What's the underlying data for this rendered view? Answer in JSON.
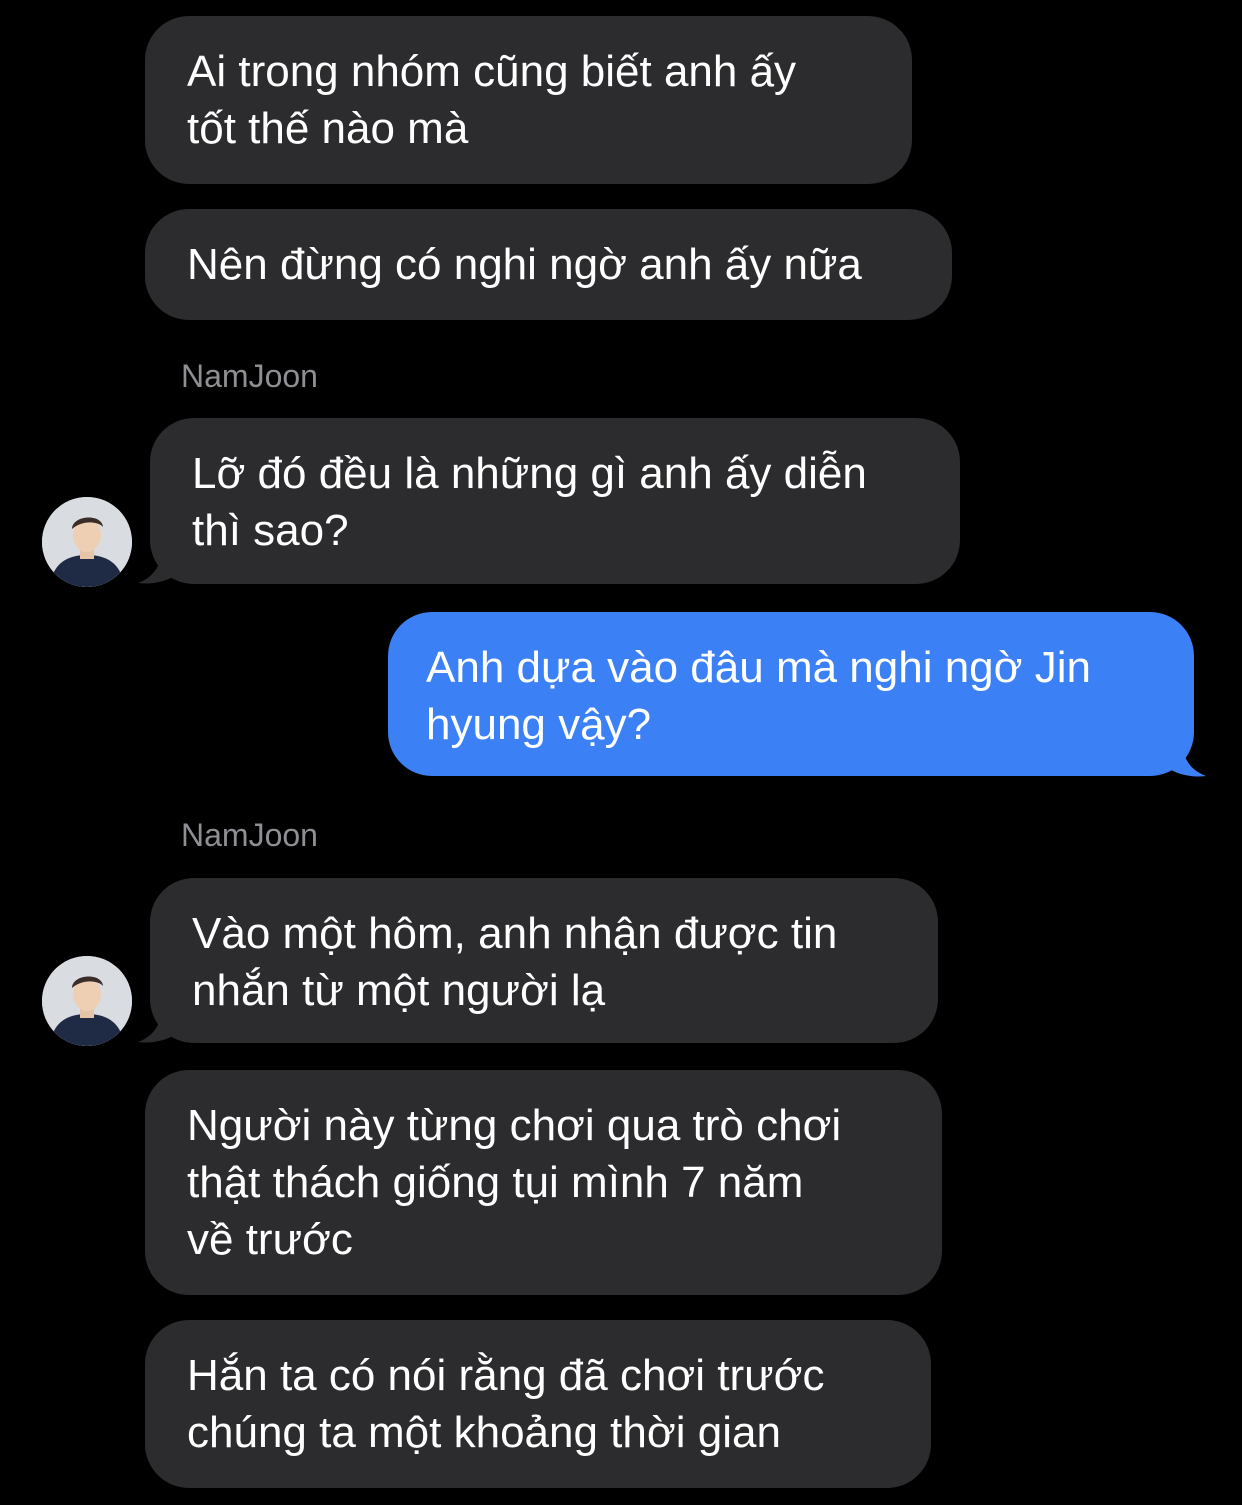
{
  "colors": {
    "background": "#000000",
    "incoming_bubble": "#2c2c2e",
    "outgoing_bubble": "#3b80f4",
    "sender_name": "#8e8e93",
    "text": "#ffffff"
  },
  "messages": [
    {
      "direction": "incoming",
      "text": "Ai trong nhóm cũng biết anh ấy\ntốt thế nào mà"
    },
    {
      "direction": "incoming",
      "text": "Nên đừng có nghi ngờ anh ấy nữa"
    },
    {
      "direction": "incoming",
      "sender": "NamJoon",
      "avatar_icon": "person-photo-icon",
      "text": "Lỡ đó đều là những gì anh ấy diễn\nthì sao?"
    },
    {
      "direction": "outgoing",
      "text": "Anh dựa vào đâu mà nghi ngờ Jin\nhyung vậy?"
    },
    {
      "direction": "incoming",
      "sender": "NamJoon",
      "avatar_icon": "person-photo-icon",
      "text": "Vào một hôm, anh nhận được tin\nnhắn từ một người lạ"
    },
    {
      "direction": "incoming",
      "text": "Người này từng chơi qua trò chơi\nthật thách giống tụi mình 7 năm\nvề trước"
    },
    {
      "direction": "incoming",
      "text": "Hắn ta có nói rằng đã chơi trước\nchúng ta một khoảng thời gian"
    }
  ]
}
